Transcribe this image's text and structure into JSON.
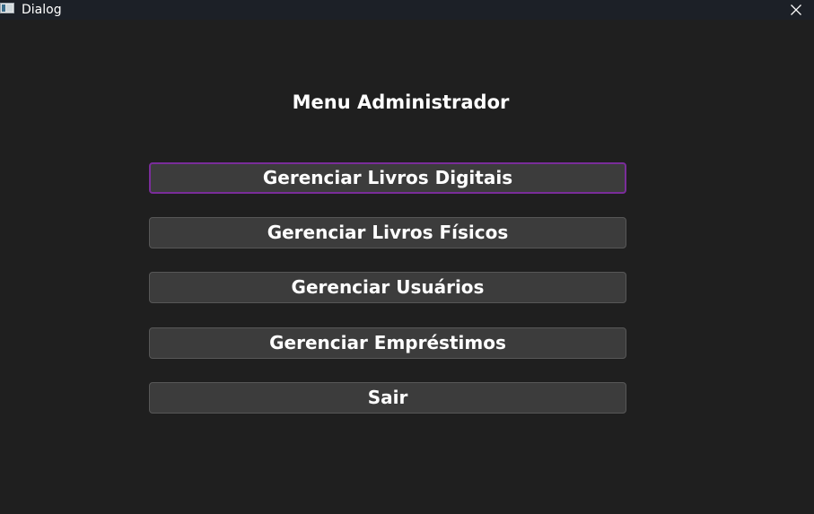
{
  "window": {
    "title": "Dialog",
    "app_icon": "app-window-icon",
    "close_icon": "close-icon"
  },
  "main": {
    "heading": "Menu Administrador",
    "buttons": [
      {
        "label": "Gerenciar Livros Digitais",
        "focused": true
      },
      {
        "label": "Gerenciar Livros Físicos",
        "focused": false
      },
      {
        "label": "Gerenciar Usuários",
        "focused": false
      },
      {
        "label": "Gerenciar Empréstimos",
        "focused": false
      },
      {
        "label": "Sair",
        "focused": false
      }
    ]
  },
  "colors": {
    "background": "#1f1f1f",
    "titlebar": "#1c2027",
    "button_bg": "#3c3c3c",
    "button_border": "#575757",
    "focus_border": "#7a2d9a",
    "text": "#ffffff"
  }
}
